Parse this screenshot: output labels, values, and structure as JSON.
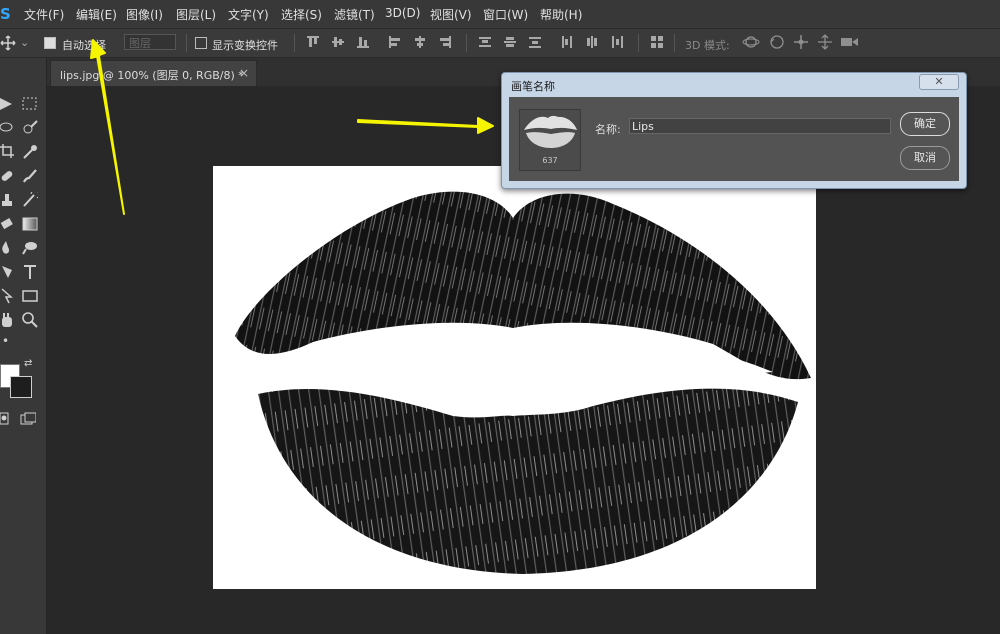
{
  "app": {
    "logo": "S"
  },
  "menu": [
    "文件(F)",
    "编辑(E)",
    "图像(I)",
    "图层(L)",
    "文字(Y)",
    "选择(S)",
    "滤镜(T)",
    "3D(D)",
    "视图(V)",
    "窗口(W)",
    "帮助(H)"
  ],
  "options_bar": {
    "auto_select_label": "自动选择",
    "auto_select_checked": true,
    "auto_select_target": "图层",
    "show_transform_label": "显示变换控件",
    "show_transform_checked": false,
    "mode_3d_label": "3D 模式:"
  },
  "document_tab": {
    "title": "lips.jpg @ 100% (图层 0, RGB/8) *",
    "close": "×"
  },
  "dialog": {
    "title": "画笔名称",
    "close": "✕",
    "brush_size": "637",
    "name_label": "名称:",
    "name_value": "Lips",
    "ok_label": "确定",
    "cancel_label": "取消"
  },
  "colors": {
    "accent": "#31a8ff",
    "annotation_arrow": "#f5f500",
    "dialog_frame": "#c7d6e6"
  }
}
